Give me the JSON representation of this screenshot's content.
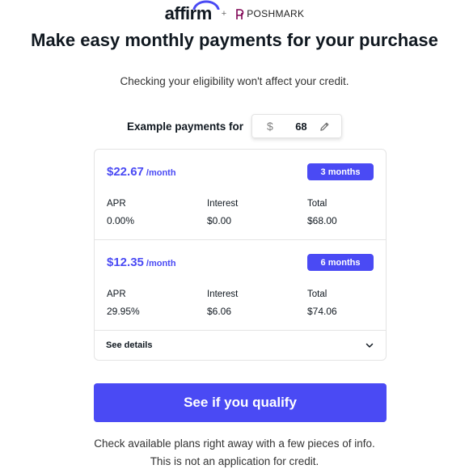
{
  "header": {
    "affirm_logo": "affirm",
    "plus": "+",
    "poshmark_logo": "POSHMARK"
  },
  "title": "Make easy monthly payments for your purchase",
  "subtitle": "Checking your eligibility won't affect your credit.",
  "amount": {
    "label": "Example payments for",
    "currency": "$",
    "value": "68"
  },
  "plans": [
    {
      "monthly": "$22.67",
      "per_month": "/month",
      "term": "3 months",
      "apr_label": "APR",
      "apr": "0.00%",
      "interest_label": "Interest",
      "interest": "$0.00",
      "total_label": "Total",
      "total": "$68.00"
    },
    {
      "monthly": "$12.35",
      "per_month": "/month",
      "term": "6 months",
      "apr_label": "APR",
      "apr": "29.95%",
      "interest_label": "Interest",
      "interest": "$6.06",
      "total_label": "Total",
      "total": "$74.06"
    }
  ],
  "see_details": "See details",
  "cta": "See if you qualify",
  "footer": {
    "line1": "Check available plans right away with a few pieces of info.",
    "line2": "This is not an application for credit."
  },
  "colors": {
    "accent": "#4a4af4",
    "text": "#101820"
  },
  "icons": {
    "edit": "pencil-icon",
    "expand": "chevron-down-icon",
    "poshmark": "poshmark-p-icon"
  }
}
